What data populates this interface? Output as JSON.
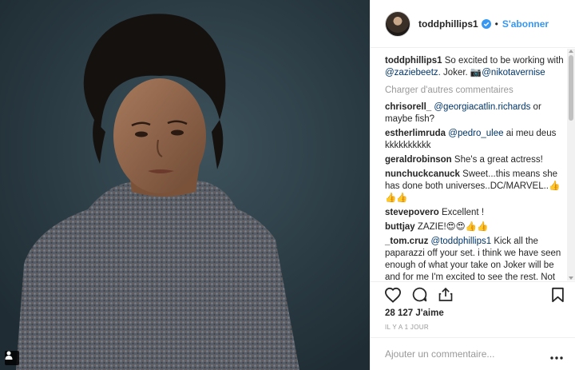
{
  "post": {
    "username": "toddphillips1",
    "follow_label": "S'abonner",
    "separator": "•",
    "caption_author": "toddphillips1",
    "caption_text": "So excited to be working with @zaziebeetz. Joker. 📷@nikotavernise",
    "load_more": "Charger d'autres commentaires",
    "likes": "28 127 J'aime",
    "time": "IL Y A 1 JOUR",
    "add_comment_placeholder": "Ajouter un commentaire..."
  },
  "comments": [
    {
      "author": "chrisorell_",
      "text": "@georgiacatlin.richards or maybe fish?"
    },
    {
      "author": "estherlimruda",
      "text": "@pedro_ulee ai meu deus kkkkkkkkkk"
    },
    {
      "author": "geraldrobinson",
      "text": "She's a great actress!"
    },
    {
      "author": "nunchuckcanuck",
      "text": "Sweet...this means she has done both universes..DC/MARVEL..👍 👍👍"
    },
    {
      "author": "stevepovero",
      "text": "Excellent !"
    },
    {
      "author": "buttjay",
      "text": "ZAZIE!😍😍👍👍"
    },
    {
      "author": "_tom.cruz",
      "text": "@toddphillips1 Kick all the paparazzi off your set. i think we have seen enough of what your take on Joker will be and for me I'm excited to see the rest. Not"
    }
  ],
  "icons": {
    "verified": "verified-badge-icon",
    "like": "heart-icon",
    "comment": "comment-bubble-icon",
    "share": "share-icon",
    "save": "bookmark-icon",
    "more": "more-dots-icon",
    "tag": "user-tag-icon"
  },
  "colors": {
    "link": "#3897f0",
    "mention": "#003569",
    "muted": "#999999",
    "verified": "#3897f0"
  }
}
